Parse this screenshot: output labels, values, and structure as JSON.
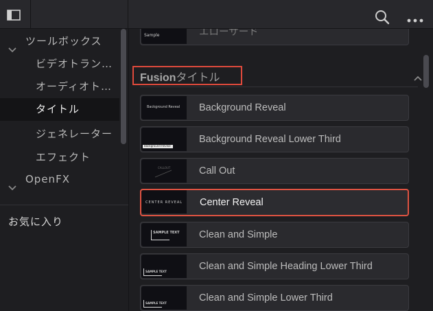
{
  "sidebar": {
    "tree": [
      {
        "label": "ツールボックス",
        "expanded": true,
        "level": 0
      },
      {
        "label": "ビデオトラン…",
        "level": 1
      },
      {
        "label": "オーディオト…",
        "level": 1
      },
      {
        "label": "タイトル",
        "level": 1,
        "selected": true
      },
      {
        "label": "ジェネレーター",
        "level": 1
      },
      {
        "label": "エフェクト",
        "level": 1
      },
      {
        "label": "OpenFX",
        "expanded": true,
        "level": 0
      }
    ],
    "favorites_label": "お気に入り"
  },
  "content": {
    "partial_top_label": "エローサード",
    "partial_top_thumb": "Sample",
    "section": {
      "title_en": "Fusion",
      "title_jp": "タイトル"
    },
    "items": [
      {
        "label": "Background Reveal",
        "thumb": "Background Reveal"
      },
      {
        "label": "Background Reveal Lower Third",
        "thumb": "Background Reveal"
      },
      {
        "label": "Call Out",
        "thumb": "CALLOUT"
      },
      {
        "label": "Center Reveal",
        "thumb": "CENTER REVEAL",
        "selected": true
      },
      {
        "label": "Clean and Simple",
        "thumb": "SAMPLE TEXT"
      },
      {
        "label": "Clean and Simple Heading Lower Third",
        "thumb": "SAMPLE TEXT"
      },
      {
        "label": "Clean and Simple Lower Third",
        "thumb": "SAMPLE TEXT"
      }
    ]
  },
  "colors": {
    "highlight": "#e05342",
    "background": "#1e1e21"
  },
  "icons": {
    "panel": "panel-toggle-icon",
    "search": "search-icon",
    "more": "more-options-icon"
  }
}
